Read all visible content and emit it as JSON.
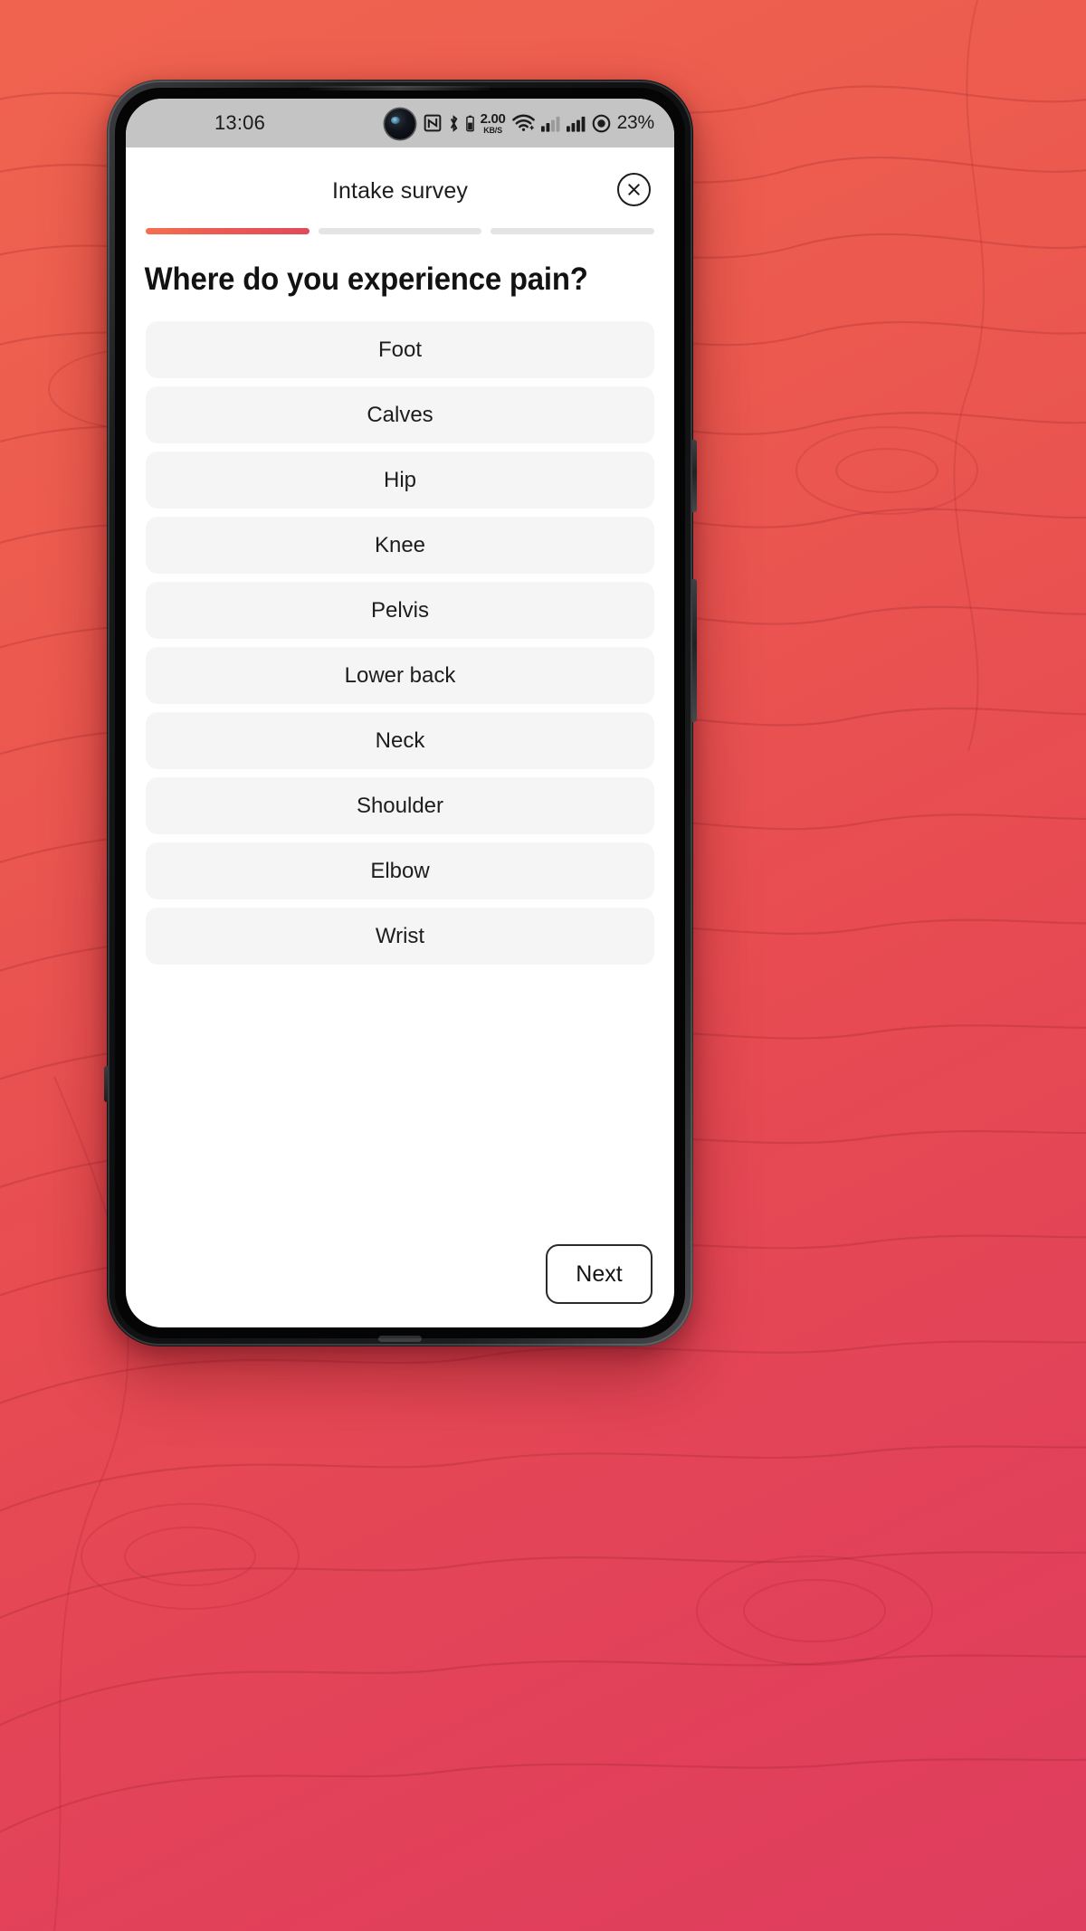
{
  "wallpaper": {
    "description": "coral topographic contour pattern",
    "color_start": "#f0644f",
    "color_end": "#df3d5e"
  },
  "status_bar": {
    "clock": "13:06",
    "background": "#c4c4c4",
    "icons": [
      "nfc-icon",
      "bluetooth-icon",
      "network-speed-indicator",
      "wifi-icon",
      "cellular-signal-sim1-icon",
      "cellular-signal-sim2-icon",
      "battery-icon"
    ],
    "network_speed_value": "2.00",
    "network_speed_unit": "KB/S",
    "battery_percent": "23%"
  },
  "header": {
    "title": "Intake survey",
    "close_label": "×"
  },
  "progress": {
    "total_steps": 3,
    "current_step": 1,
    "fill_color_start": "#f4704f",
    "fill_color_end": "#e04a5b",
    "track_color": "#e4e4e4"
  },
  "question": {
    "text": "Where do you experience pain?"
  },
  "options": [
    {
      "label": "Foot"
    },
    {
      "label": "Calves"
    },
    {
      "label": "Hip"
    },
    {
      "label": "Knee"
    },
    {
      "label": "Pelvis"
    },
    {
      "label": "Lower back"
    },
    {
      "label": "Neck"
    },
    {
      "label": "Shoulder"
    },
    {
      "label": "Elbow"
    },
    {
      "label": "Wrist"
    }
  ],
  "footer": {
    "next_label": "Next"
  }
}
